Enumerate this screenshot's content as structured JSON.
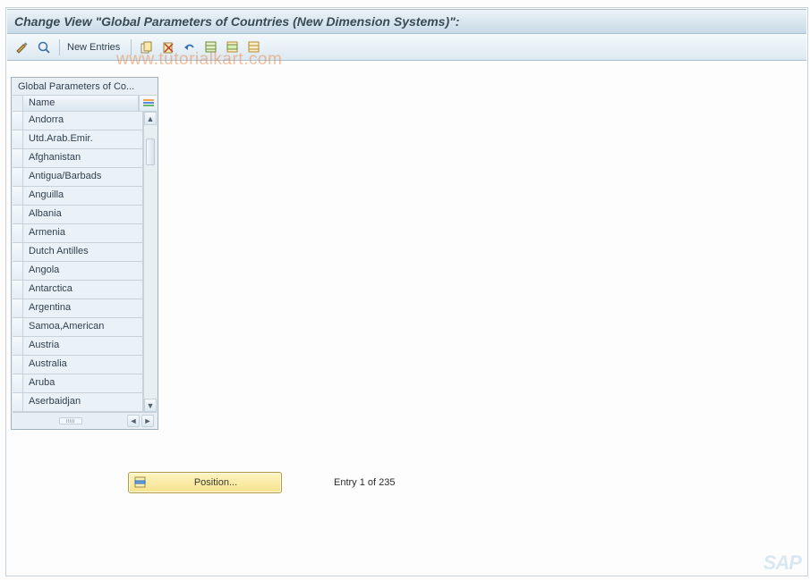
{
  "title": "Change View \"Global Parameters of Countries (New Dimension Systems)\":",
  "watermark": "www.tutorialkart.com",
  "toolbar": {
    "new_entries_label": "New Entries"
  },
  "panel": {
    "title": "Global Parameters of Co...",
    "column_header": "Name",
    "rows": [
      "Andorra",
      "Utd.Arab.Emir.",
      "Afghanistan",
      "Antigua/Barbads",
      "Anguilla",
      "Albania",
      "Armenia",
      "Dutch Antilles",
      "Angola",
      "Antarctica",
      "Argentina",
      "Samoa,American",
      "Austria",
      "Australia",
      "Aruba",
      "Aserbaidjan"
    ]
  },
  "position_button": "Position...",
  "entry_status": "Entry 1 of 235",
  "corner_logo": "SAP"
}
